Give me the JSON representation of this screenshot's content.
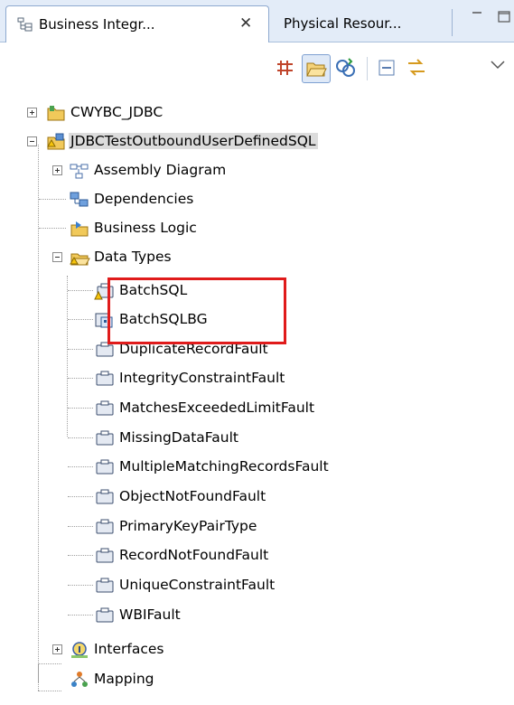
{
  "tabs": {
    "active": {
      "label": "Business Integr...",
      "icon": "business-integration-icon"
    },
    "inactive": {
      "label": "Physical Resour..."
    }
  },
  "toolbar": {
    "buttons": [
      "grid-icon",
      "open-folder-icon",
      "link-icon",
      "collapse-all-icon",
      "sync-icon",
      "view-menu-icon"
    ]
  },
  "tree": {
    "items": [
      {
        "label": "CWYBC_JDBC",
        "icon": "library-project-icon"
      },
      {
        "label": "JDBCTestOutboundUserDefinedSQL",
        "icon": "module-project-icon"
      },
      {
        "label": "Assembly Diagram",
        "icon": "assembly-diagram-icon"
      },
      {
        "label": "Dependencies",
        "icon": "dependencies-icon"
      },
      {
        "label": "Business Logic",
        "icon": "business-logic-icon"
      },
      {
        "label": "Data Types",
        "icon": "data-types-folder-icon"
      },
      {
        "label": "BatchSQL",
        "icon": "business-object-warning-icon"
      },
      {
        "label": "BatchSQLBG",
        "icon": "business-graph-icon"
      },
      {
        "label": "DuplicateRecordFault",
        "icon": "business-object-icon"
      },
      {
        "label": "IntegrityConstraintFault",
        "icon": "business-object-icon"
      },
      {
        "label": "MatchesExceededLimitFault",
        "icon": "business-object-icon"
      },
      {
        "label": "MissingDataFault",
        "icon": "business-object-icon"
      },
      {
        "label": "MultipleMatchingRecordsFault",
        "icon": "business-object-icon"
      },
      {
        "label": "ObjectNotFoundFault",
        "icon": "business-object-icon"
      },
      {
        "label": "PrimaryKeyPairType",
        "icon": "business-object-icon"
      },
      {
        "label": "RecordNotFoundFault",
        "icon": "business-object-icon"
      },
      {
        "label": "UniqueConstraintFault",
        "icon": "business-object-icon"
      },
      {
        "label": "WBIFault",
        "icon": "business-object-icon"
      },
      {
        "label": "Interfaces",
        "icon": "interfaces-icon"
      },
      {
        "label": "Mapping",
        "icon": "mapping-icon"
      }
    ]
  },
  "colors": {
    "highlight": "#e01b1b",
    "tab_bar": "#e3ecf8",
    "selection": "#dcdcdc"
  }
}
